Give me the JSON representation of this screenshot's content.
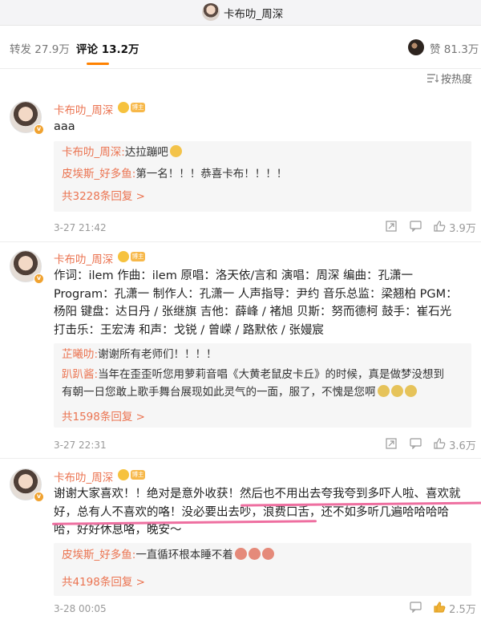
{
  "header": {
    "title": "卡布叻_周深"
  },
  "tabs": {
    "repost": "转发 27.9万",
    "comment": "评论 13.2万",
    "like": "赞 81.3万"
  },
  "sort": {
    "label": "按热度",
    "icon": "sort-icon"
  },
  "colors": {
    "accent": "#ff8200",
    "username": "#eb7350",
    "highlight": "#ee6fa0"
  },
  "comments": [
    {
      "user": "卡布叻_周深",
      "badge": "博主",
      "text": [
        "aaa"
      ],
      "replies": [
        {
          "user": "卡布叻_周深:",
          "text": "达拉蹦吧"
        },
        {
          "user": "皮埃斯_好多鱼:",
          "text": "第一名！！！恭喜卡布！！！！"
        }
      ],
      "more": "共3228条回复 >",
      "time": "3-27 21:42",
      "likes": "3.9万"
    },
    {
      "user": "卡布叻_周深",
      "badge": "博主",
      "text": [
        "作词：ilem 作曲：ilem 原唱：洛天依/言和 演唱：周深 编曲：孔潇一",
        "Program：孔潇一 制作人：孔潇一 人声指导：尹约 音乐总监：梁翘柏 PGM：",
        "杨阳 键盘：达日丹 / 张继旗 吉他：薛峰 / 褚旭 贝斯：努而德柯 鼓手：崔石光",
        "打击乐：王宏涛 和声：戈锐 / 曾嵘 / 路默依 / 张嫚宸"
      ],
      "replies": [
        {
          "user": "芷曦叻:",
          "text": "谢谢所有老师们！！！！"
        },
        {
          "user": "趴趴酱:",
          "text": "当年在歪歪听您用萝莉音唱《大黄老鼠皮卡丘》的时候，真是做梦没想到"
        },
        {
          "user": "",
          "text": "有朝一日您敢上歌手舞台展现如此灵气的一面，服了，不愧是您啊"
        }
      ],
      "more": "共1598条回复 >",
      "time": "3-27 22:31",
      "likes": "3.6万"
    },
    {
      "user": "卡布叻_周深",
      "badge": "博主",
      "text": [
        "谢谢大家喜欢！！绝对是意外收获！然后也不用出去夸我夸到多吓人啦、喜欢就",
        "好，总有人不喜欢的咯！没必要出去吵，浪费口舌，还不如多听几遍哈哈哈哈",
        "哈，好好休息咯，晚安～"
      ],
      "replies": [
        {
          "user": "皮埃斯_好多鱼:",
          "text": "一直循环根本睡不着"
        }
      ],
      "more": "共4198条回复 >",
      "time": "3-28 00:05",
      "likes": "2.5万"
    }
  ]
}
